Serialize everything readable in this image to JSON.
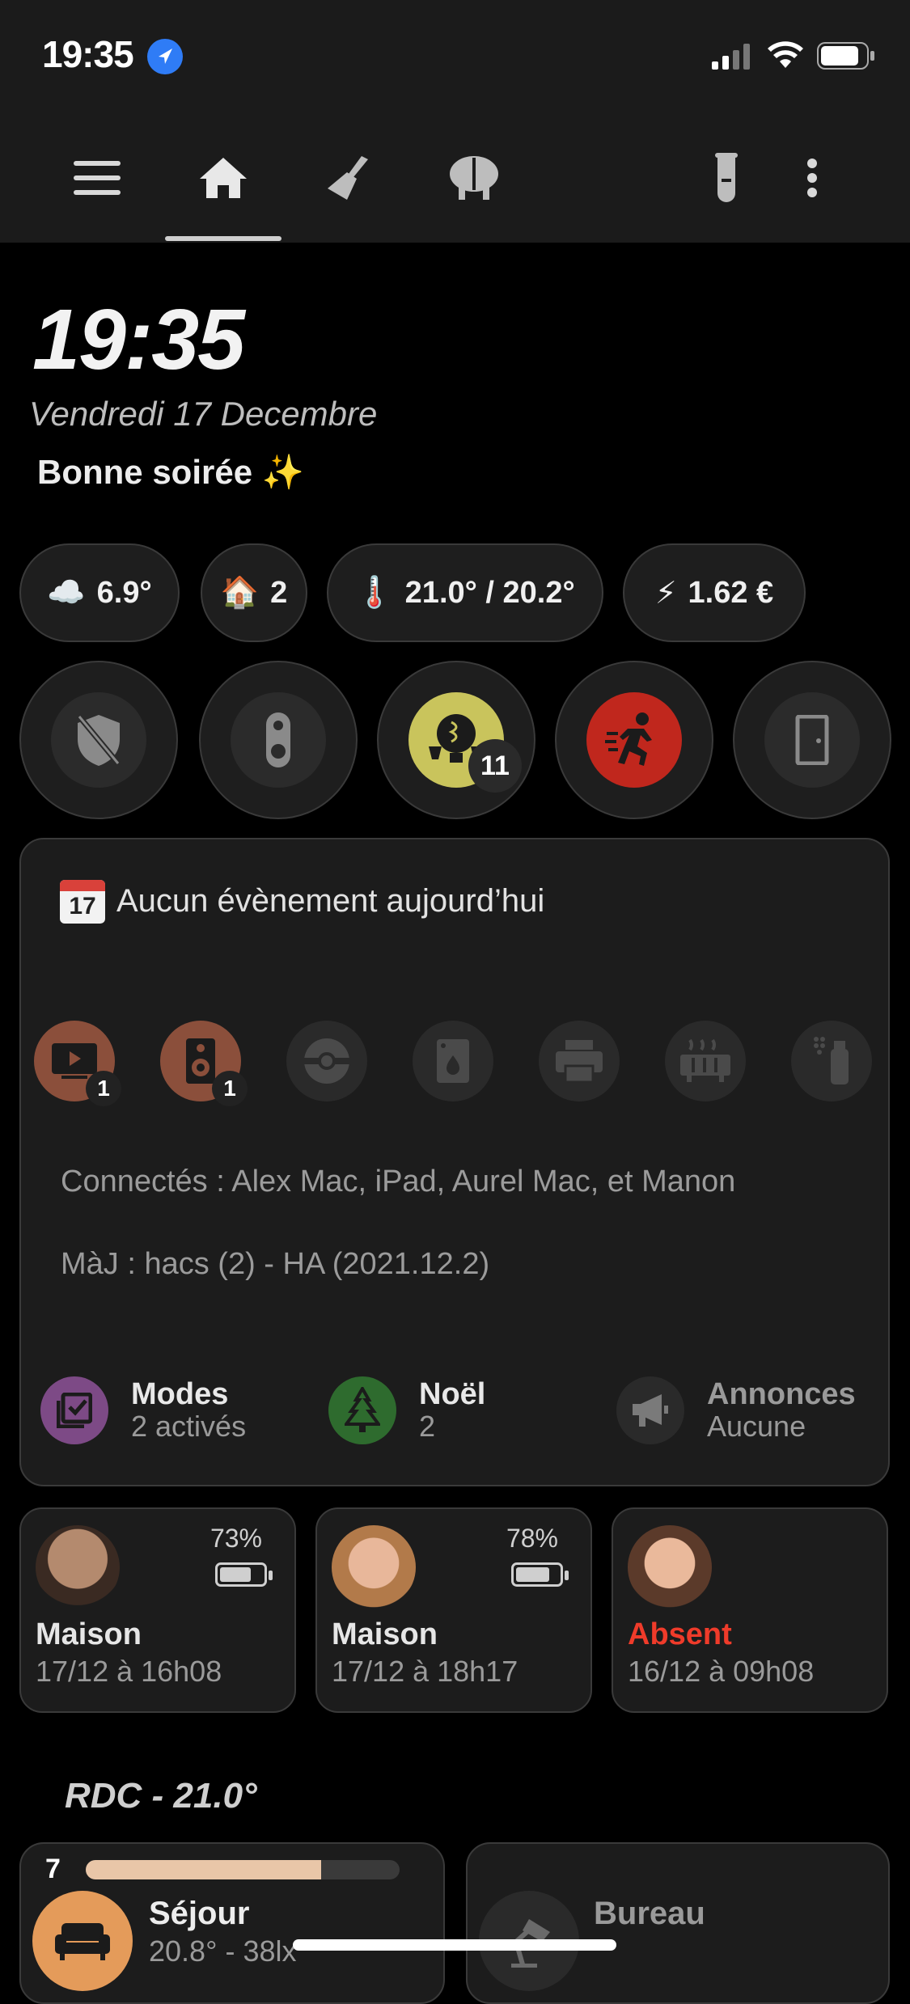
{
  "status_bar": {
    "time": "19:35"
  },
  "nav": {
    "tabs": [
      "menu-icon",
      "home-icon",
      "broom-icon",
      "brain-icon",
      "test-tube-icon",
      "more-icon"
    ]
  },
  "header": {
    "clock": "19:35",
    "date": "Vendredi 17 Decembre",
    "greeting": "Bonne soirée ✨"
  },
  "chips": [
    {
      "icon": "☁️",
      "text": "6.9°"
    },
    {
      "icon": "🏠",
      "text": "2"
    },
    {
      "icon": "🌡️",
      "text": "21.0° / 20.2°"
    },
    {
      "icon": "⚡",
      "text": "1.62 €"
    }
  ],
  "quick_buttons": {
    "lights_count": "11"
  },
  "info": {
    "calendar": "Aucun évènement aujourd’hui",
    "calendar_icon_num": "17",
    "devices": [
      {
        "name": "tv-icon",
        "badge": "1",
        "color": "#8b4f3b"
      },
      {
        "name": "speaker-icon",
        "badge": "1",
        "color": "#8b4f3b"
      },
      {
        "name": "robot-vacuum-icon",
        "badge": "",
        "color": "#2a2a2a"
      },
      {
        "name": "washing-machine-icon",
        "badge": "",
        "color": "#2a2a2a"
      },
      {
        "name": "printer-icon",
        "badge": "",
        "color": "#2a2a2a"
      },
      {
        "name": "radiator-icon",
        "badge": "",
        "color": "#2a2a2a"
      },
      {
        "name": "spray-icon",
        "badge": "",
        "color": "#2a2a2a"
      }
    ],
    "connected": "Connectés : Alex Mac, iPad, Aurel Mac, et Manon",
    "updates": "MàJ : hacs (2) - HA (2021.12.2)",
    "modes": [
      {
        "title": "Modes",
        "sub": "2 activés",
        "color": "#7d4a86"
      },
      {
        "title": "Noël",
        "sub": "2",
        "color": "#2e6b2e"
      },
      {
        "title": "Annonces",
        "sub": "Aucune",
        "color": "#2a2a2a"
      }
    ]
  },
  "people": [
    {
      "pct": "73%",
      "battery": 0.73,
      "status": "Maison",
      "time": "17/12 à 16h08",
      "status_color": "#e6e6e6"
    },
    {
      "pct": "78%",
      "battery": 0.78,
      "status": "Maison",
      "time": "17/12 à 18h17",
      "status_color": "#e6e6e6"
    },
    {
      "pct": "",
      "battery": 0,
      "status": "Absent",
      "time": "16/12 à 09h08",
      "status_color": "#ef3b2a"
    }
  ],
  "floor": {
    "title": "RDC - 21.0°",
    "rooms": [
      {
        "count": "7",
        "name": "Séjour",
        "detail": "20.8° - 38lx",
        "progress": 0.75
      },
      {
        "name": "Bureau"
      }
    ]
  }
}
